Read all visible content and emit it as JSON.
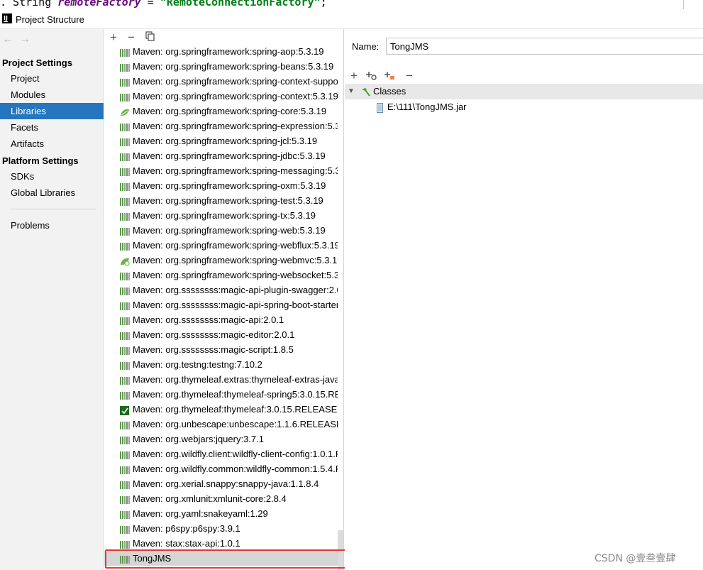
{
  "code_line": {
    "prefix": ". String ",
    "var": "remoteFactory",
    "mid": " = ",
    "value": "\"RemoteConnectionFactory\"",
    "suffix": ";"
  },
  "window": {
    "title": "Project Structure",
    "app_icon_text": "IJ"
  },
  "nav": {
    "back_icon": "←",
    "forward_icon": "→",
    "sections": [
      {
        "title": "Project Settings",
        "items": [
          "Project",
          "Modules",
          "Libraries",
          "Facets",
          "Artifacts"
        ]
      },
      {
        "title": "Platform Settings",
        "items": [
          "SDKs",
          "Global Libraries"
        ]
      }
    ],
    "problems_label": "Problems",
    "selected": "Libraries"
  },
  "libraries_toolbar": {
    "add": "+",
    "remove": "−",
    "copy": "copy"
  },
  "libraries": [
    {
      "label": "Maven: org.springframework:spring-aop:5.3.19",
      "icon": "maven"
    },
    {
      "label": "Maven: org.springframework:spring-beans:5.3.19",
      "icon": "maven"
    },
    {
      "label": "Maven: org.springframework:spring-context-suppo",
      "icon": "maven"
    },
    {
      "label": "Maven: org.springframework:spring-context:5.3.19",
      "icon": "maven"
    },
    {
      "label": "Maven: org.springframework:spring-core:5.3.19",
      "icon": "spring"
    },
    {
      "label": "Maven: org.springframework:spring-expression:5.3",
      "icon": "maven"
    },
    {
      "label": "Maven: org.springframework:spring-jcl:5.3.19",
      "icon": "maven"
    },
    {
      "label": "Maven: org.springframework:spring-jdbc:5.3.19",
      "icon": "maven"
    },
    {
      "label": "Maven: org.springframework:spring-messaging:5.3",
      "icon": "maven"
    },
    {
      "label": "Maven: org.springframework:spring-oxm:5.3.19",
      "icon": "maven"
    },
    {
      "label": "Maven: org.springframework:spring-test:5.3.19",
      "icon": "maven"
    },
    {
      "label": "Maven: org.springframework:spring-tx:5.3.19",
      "icon": "maven"
    },
    {
      "label": "Maven: org.springframework:spring-web:5.3.19",
      "icon": "maven"
    },
    {
      "label": "Maven: org.springframework:spring-webflux:5.3.19",
      "icon": "maven"
    },
    {
      "label": "Maven: org.springframework:spring-webmvc:5.3.19",
      "icon": "spring-mvc"
    },
    {
      "label": "Maven: org.springframework:spring-websocket:5.3",
      "icon": "maven"
    },
    {
      "label": "Maven: org.ssssssss:magic-api-plugin-swagger:2.0.",
      "icon": "maven"
    },
    {
      "label": "Maven: org.ssssssss:magic-api-spring-boot-starter",
      "icon": "maven"
    },
    {
      "label": "Maven: org.ssssssss:magic-api:2.0.1",
      "icon": "maven"
    },
    {
      "label": "Maven: org.ssssssss:magic-editor:2.0.1",
      "icon": "maven"
    },
    {
      "label": "Maven: org.ssssssss:magic-script:1.8.5",
      "icon": "maven"
    },
    {
      "label": "Maven: org.testng:testng:7.10.2",
      "icon": "maven"
    },
    {
      "label": "Maven: org.thymeleaf.extras:thymeleaf-extras-java8",
      "icon": "maven"
    },
    {
      "label": "Maven: org.thymeleaf:thymeleaf-spring5:3.0.15.RELE",
      "icon": "maven"
    },
    {
      "label": "Maven: org.thymeleaf:thymeleaf:3.0.15.RELEASE",
      "icon": "thymeleaf"
    },
    {
      "label": "Maven: org.unbescape:unbescape:1.1.6.RELEASE",
      "icon": "maven"
    },
    {
      "label": "Maven: org.webjars:jquery:3.7.1",
      "icon": "maven"
    },
    {
      "label": "Maven: org.wildfly.client:wildfly-client-config:1.0.1.Fi",
      "icon": "maven"
    },
    {
      "label": "Maven: org.wildfly.common:wildfly-common:1.5.4.Fi",
      "icon": "maven"
    },
    {
      "label": "Maven: org.xerial.snappy:snappy-java:1.1.8.4",
      "icon": "maven"
    },
    {
      "label": "Maven: org.xmlunit:xmlunit-core:2.8.4",
      "icon": "maven"
    },
    {
      "label": "Maven: org.yaml:snakeyaml:1.29",
      "icon": "maven"
    },
    {
      "label": "Maven: p6spy:p6spy:3.9.1",
      "icon": "maven"
    },
    {
      "label": "Maven: stax:stax-api:1.0.1",
      "icon": "maven"
    },
    {
      "label": "TongJMS",
      "icon": "maven",
      "selected": true
    }
  ],
  "detail": {
    "name_label": "Name:",
    "name_value": "TongJMS",
    "toolbar": [
      "+",
      "+",
      "+",
      "−"
    ],
    "classes_label": "Classes",
    "jar_path": "E:\\111\\TongJMS.jar"
  },
  "watermark": "CSDN @壹叁壹肆"
}
